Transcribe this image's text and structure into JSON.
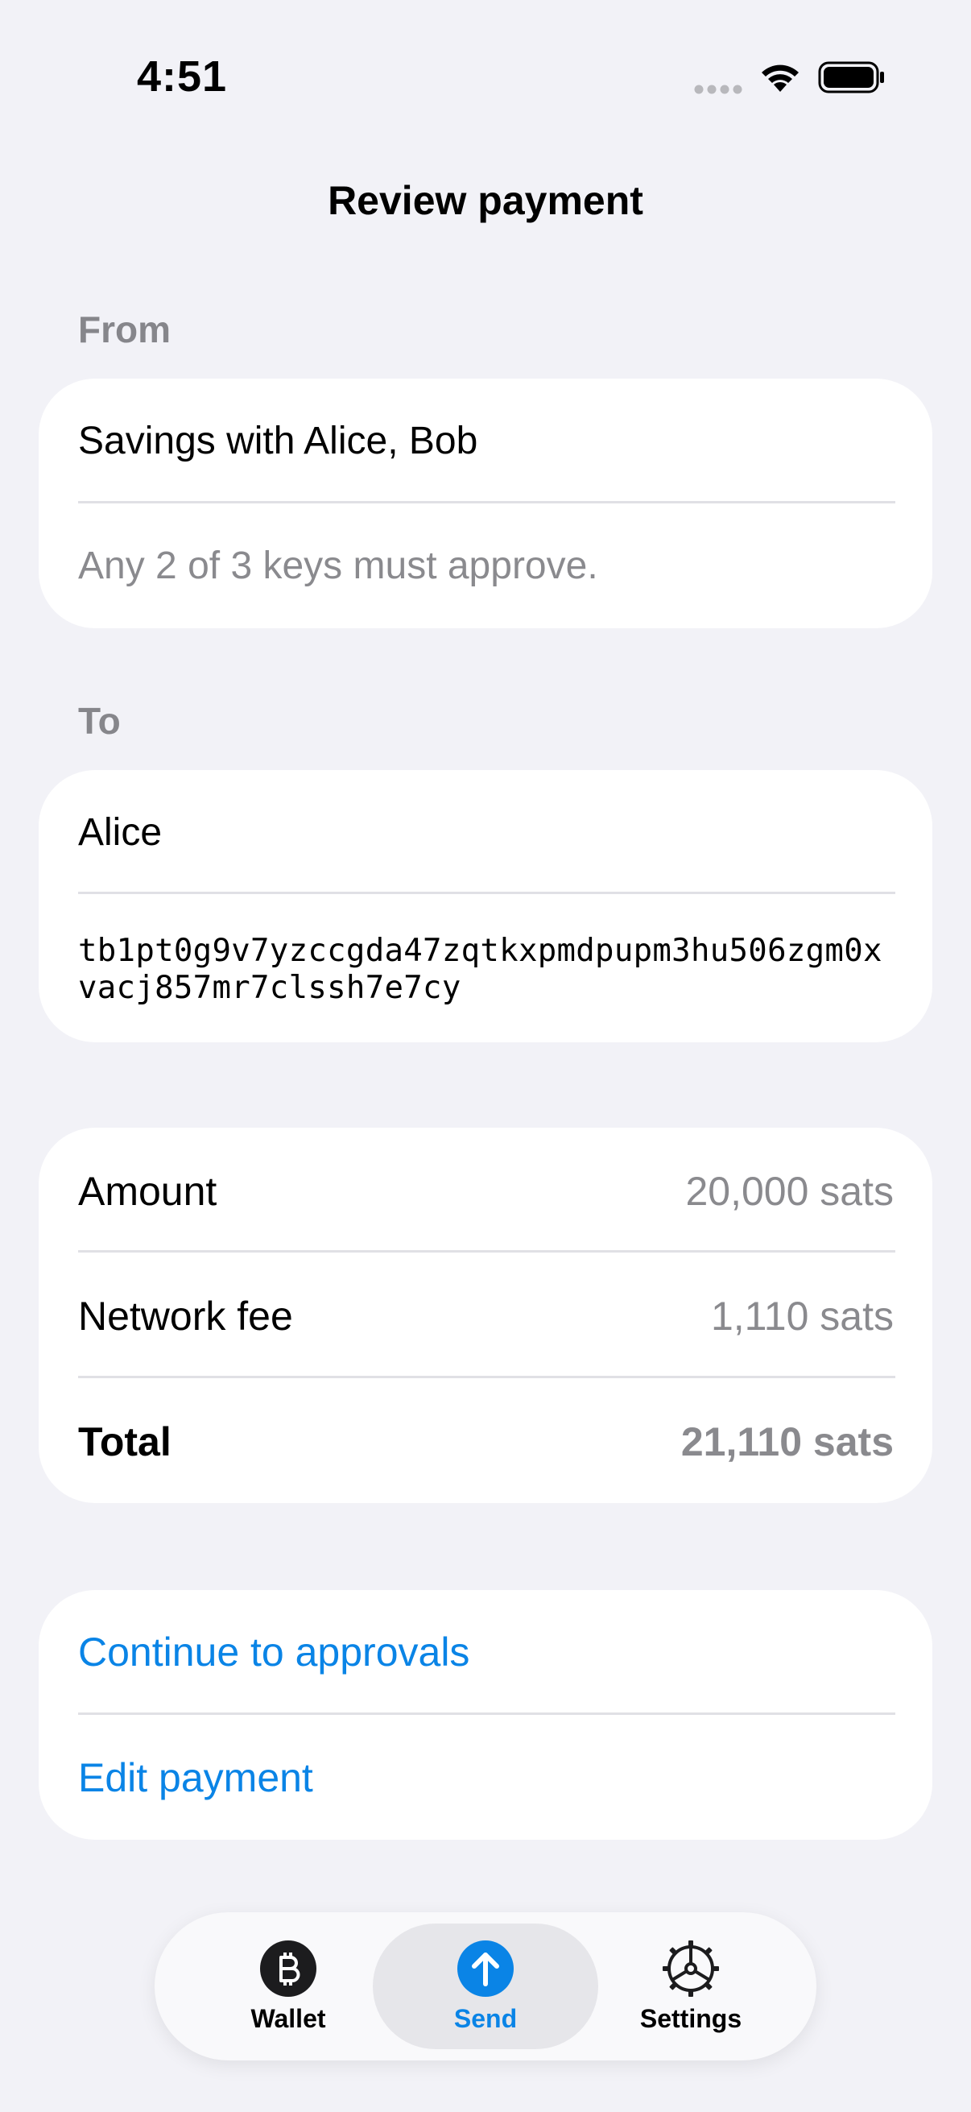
{
  "status_bar": {
    "time": "4:51"
  },
  "nav": {
    "title": "Review payment"
  },
  "from": {
    "label": "From",
    "name": "Savings with Alice, Bob",
    "policy": "Any 2 of 3 keys must approve."
  },
  "to": {
    "label": "To",
    "name": "Alice",
    "address": "tb1pt0g9v7yzccgda47zqtkxpmdpupm3hu506zgm0xvacj857mr7clssh7e7cy"
  },
  "summary": {
    "amount_label": "Amount",
    "amount_value": "20,000 sats",
    "fee_label": "Network fee",
    "fee_value": "1,110 sats",
    "total_label": "Total",
    "total_value": "21,110 sats"
  },
  "actions": {
    "continue_label": "Continue to approvals",
    "edit_label": "Edit payment"
  },
  "tab_bar": {
    "tabs": [
      {
        "label": "Wallet",
        "icon": "bitcoin-icon"
      },
      {
        "label": "Send",
        "icon": "arrow-up-icon"
      },
      {
        "label": "Settings",
        "icon": "steering-wheel-icon"
      }
    ],
    "active_tab": "Send"
  },
  "colors": {
    "accent": "#0a84e6",
    "background": "#f2f2f7",
    "secondary_text": "#8a8a8e"
  }
}
